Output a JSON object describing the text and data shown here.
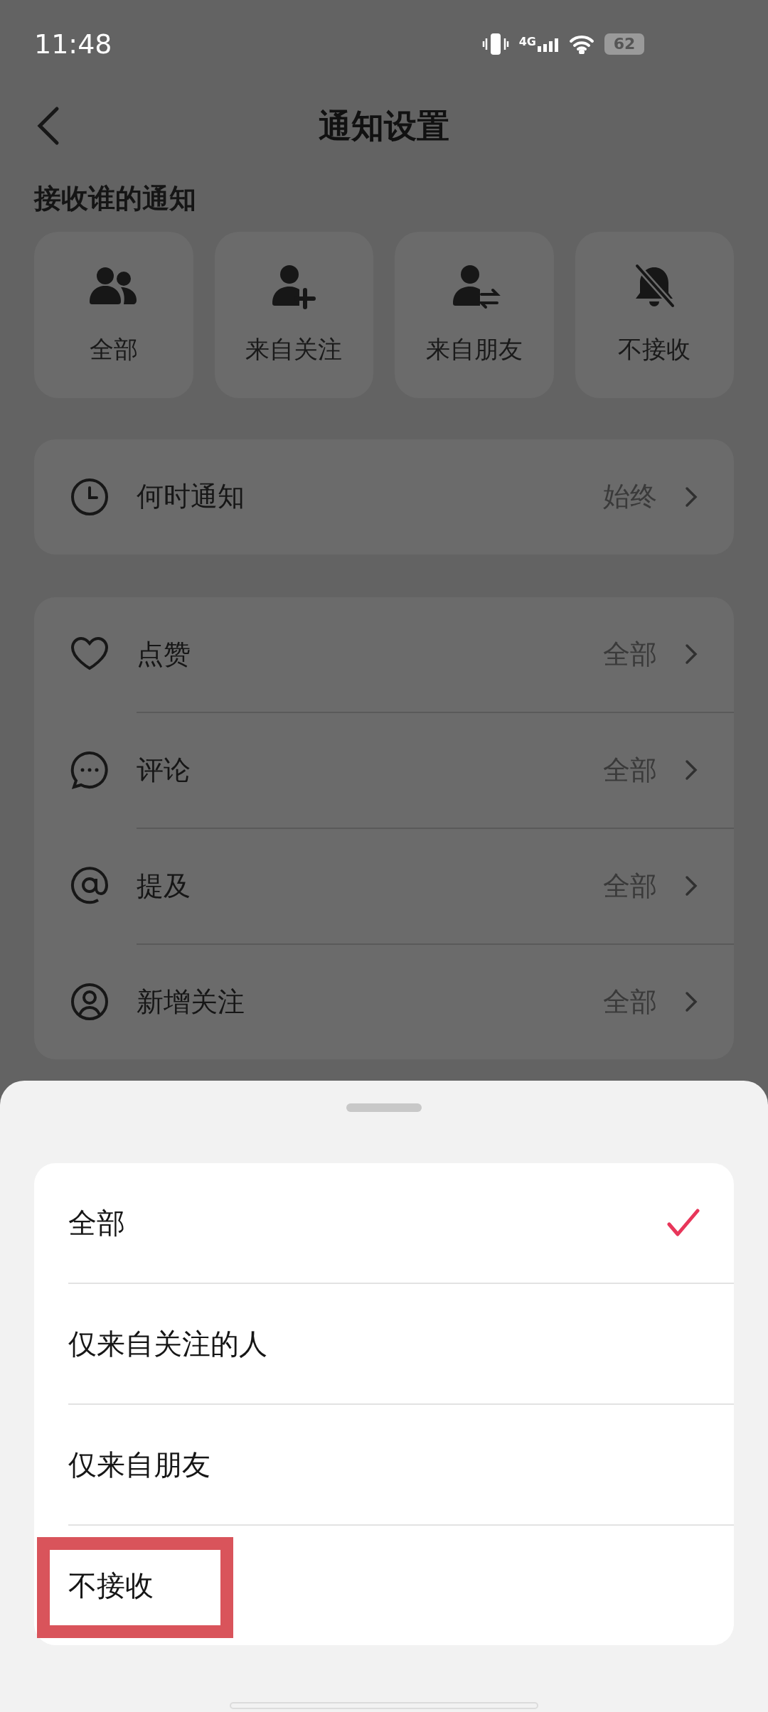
{
  "status_bar": {
    "time": "11:48",
    "network": "4G",
    "battery": "62"
  },
  "header": {
    "title": "通知设置"
  },
  "section_title": "接收谁的通知",
  "audience_tiles": [
    {
      "label": "全部"
    },
    {
      "label": "来自关注"
    },
    {
      "label": "来自朋友"
    },
    {
      "label": "不接收"
    }
  ],
  "when_row": {
    "label": "何时通知",
    "value": "始终"
  },
  "settings": [
    {
      "label": "点赞",
      "value": "全部"
    },
    {
      "label": "评论",
      "value": "全部"
    },
    {
      "label": "提及",
      "value": "全部"
    },
    {
      "label": "新增关注",
      "value": "全部"
    }
  ],
  "sheet": {
    "options": [
      {
        "label": "全部",
        "selected": true,
        "highlighted": false
      },
      {
        "label": "仅来自关注的人",
        "selected": false,
        "highlighted": false
      },
      {
        "label": "仅来自朋友",
        "selected": false,
        "highlighted": false
      },
      {
        "label": "不接收",
        "selected": false,
        "highlighted": true
      }
    ]
  }
}
